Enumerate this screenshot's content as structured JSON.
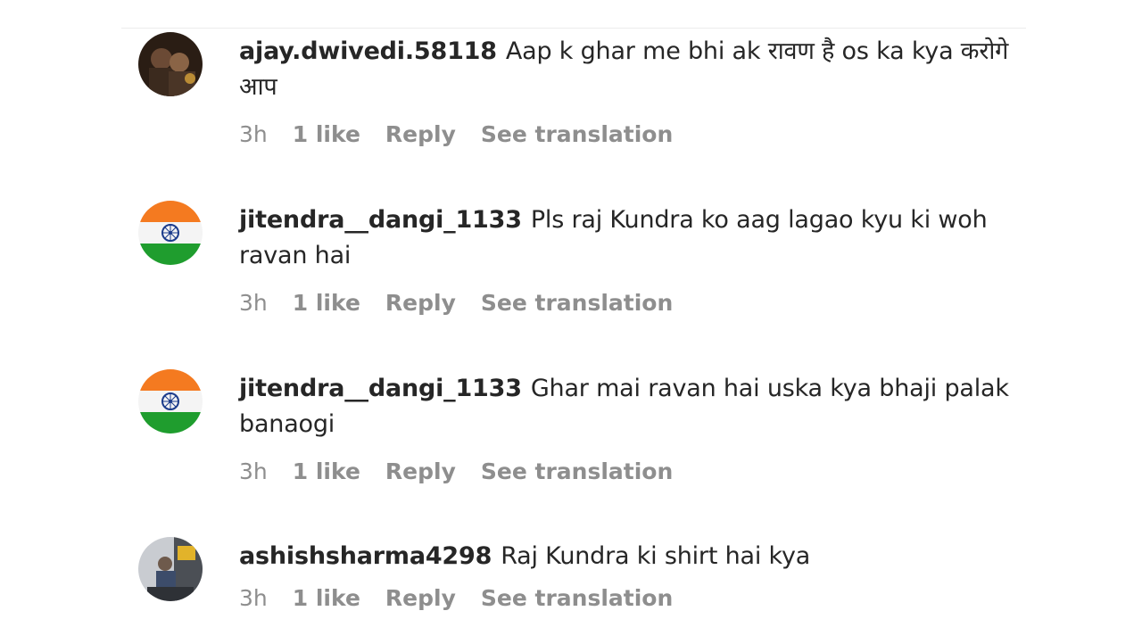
{
  "comments": [
    {
      "username": "ajay.dwivedi.58118",
      "text": "Aap k ghar me bhi ak रावण है os ka kya करोगे आप",
      "time": "3h",
      "likes": "1 like",
      "reply_label": "Reply",
      "translate_label": "See translation",
      "avatar": "photo-couple-avatar"
    },
    {
      "username": "jitendra__dangi_1133",
      "text": "Pls raj Kundra ko aag lagao kyu ki woh ravan hai",
      "time": "3h",
      "likes": "1 like",
      "reply_label": "Reply",
      "translate_label": "See translation",
      "avatar": "india-flag-avatar"
    },
    {
      "username": "jitendra__dangi_1133",
      "text": "Ghar mai ravan hai uska kya bhaji palak banaogi",
      "time": "3h",
      "likes": "1 like",
      "reply_label": "Reply",
      "translate_label": "See translation",
      "avatar": "india-flag-avatar"
    },
    {
      "username": "ashishsharma4298",
      "text": "Raj Kundra ki shirt hai kya",
      "time": "3h",
      "likes": "1 like",
      "reply_label": "Reply",
      "translate_label": "See translation",
      "avatar": "photo-person-avatar"
    }
  ],
  "colors": {
    "text": "#262626",
    "meta": "#8e8e8e",
    "saffron": "#f47a20",
    "green": "#1f9d2e",
    "chakra": "#1b3b8b"
  }
}
